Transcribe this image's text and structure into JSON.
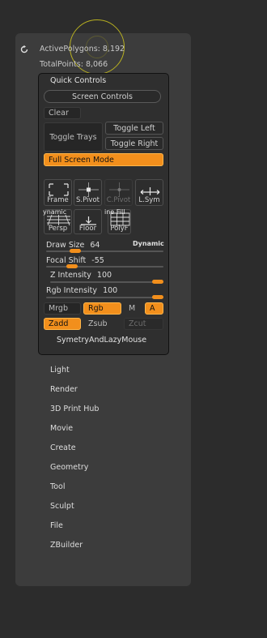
{
  "stats": {
    "active_polygons": "ActivePolygons: 8,192",
    "total_points": "TotalPoints: 8,066"
  },
  "quick_controls": {
    "title": "Quick Controls",
    "screen_controls": "Screen Controls",
    "clear": "Clear",
    "toggle_trays": "Toggle Trays",
    "toggle_left": "Toggle Left",
    "toggle_right": "Toggle Right",
    "full_screen_mode": "Full Screen Mode",
    "tools_row1": {
      "frame": "Frame",
      "spivot": "S.Pivot",
      "cpivot": "C.Pivot",
      "lsym": "L.Sym"
    },
    "tools_row2": {
      "persp": "Persp",
      "floor": "Floor",
      "polyf": "PolyF",
      "overlap_left": "ynamic",
      "overlap_right": "ine Fill"
    },
    "sliders": {
      "draw_size": {
        "label": "Draw Size",
        "value": "64",
        "badge": "Dynamic",
        "level": 0.12
      },
      "focal_shift": {
        "label": "Focal Shift",
        "value": "-55",
        "level": 0.22
      },
      "z_intensity": {
        "label": "Z Intensity",
        "value": "100",
        "level": 1.0
      },
      "rgb_intensity": {
        "label": "Rgb Intensity",
        "value": "100",
        "level": 1.0
      }
    },
    "mode_row": {
      "mrgb": "Mrgb",
      "rgb": "Rgb",
      "m": "M",
      "a": "A"
    },
    "sculpt_row": {
      "zadd": "Zadd",
      "zsub": "Zsub",
      "zcut": "Zcut"
    },
    "symmetry": "SymetryAndLazyMouse"
  },
  "menu": [
    "Light",
    "Render",
    "3D Print Hub",
    "Movie",
    "Create",
    "Geometry",
    "Tool",
    "Sculpt",
    "File",
    "ZBuilder"
  ],
  "colors": {
    "accent": "#f28f1c",
    "panel": "#3c3c3c",
    "background": "#2c2c2c"
  }
}
